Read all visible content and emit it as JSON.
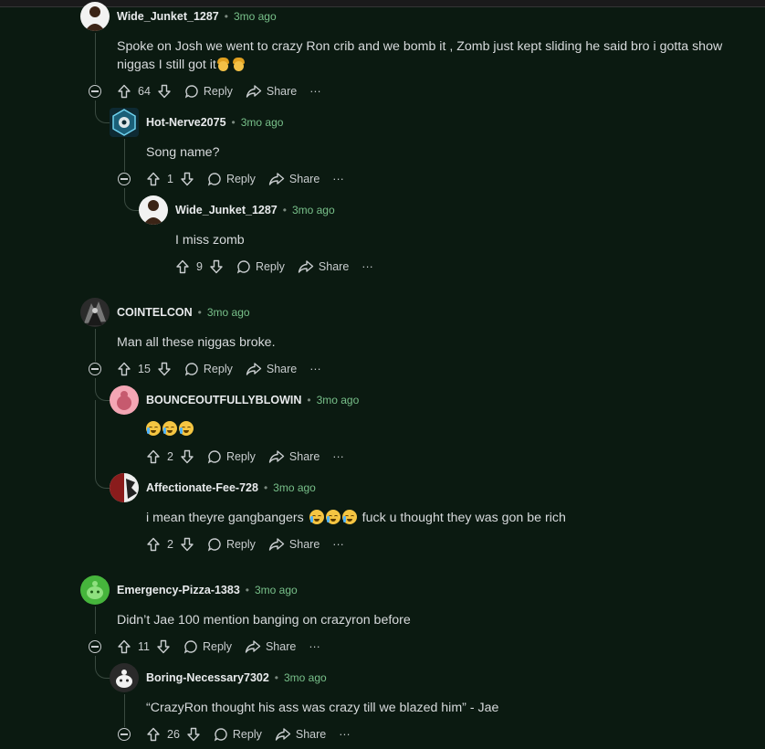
{
  "comments": [
    {
      "user": "Wide_Junket_1287",
      "time": "3mo ago",
      "text": "Spoke on Josh we went to crazy Ron crib and we bomb it , Zomb just kept sliding he said bro i gotta show",
      "text2": "niggas I still got it",
      "votes": "64",
      "reply": "Reply",
      "share": "Share",
      "more": "···"
    },
    {
      "user": "Hot-Nerve2075",
      "time": "3mo ago",
      "text": "Song name?",
      "votes": "1",
      "reply": "Reply",
      "share": "Share",
      "more": "···"
    },
    {
      "user": "Wide_Junket_1287",
      "time": "3mo ago",
      "text": "I miss zomb",
      "votes": "9",
      "reply": "Reply",
      "share": "Share",
      "more": "···"
    },
    {
      "user": "COINTELCON",
      "time": "3mo ago",
      "text": "Man all these niggas broke.",
      "votes": "15",
      "reply": "Reply",
      "share": "Share",
      "more": "···"
    },
    {
      "user": "BOUNCEOUTFULLYBLOWIN",
      "time": "3mo ago",
      "text": "",
      "votes": "2",
      "reply": "Reply",
      "share": "Share",
      "more": "···"
    },
    {
      "user": "Affectionate-Fee-728",
      "time": "3mo ago",
      "text": "i mean theyre gangbangers",
      "text2": "fuck u thought they was gon be rich",
      "votes": "2",
      "reply": "Reply",
      "share": "Share",
      "more": "···"
    },
    {
      "user": "Emergency-Pizza-1383",
      "time": "3mo ago",
      "text": "Didn’t Jae 100 mention banging on crazyron before",
      "votes": "11",
      "reply": "Reply",
      "share": "Share",
      "more": "···"
    },
    {
      "user": "Boring-Necessary7302",
      "time": "3mo ago",
      "text": "“CrazyRon thought his ass was crazy till we blazed him” - Jae",
      "votes": "26",
      "reply": "Reply",
      "share": "Share",
      "more": "···"
    }
  ],
  "colors": {
    "background": "#0b1a11",
    "timestamp": "#78c08a",
    "thread_line": "#3a4a40"
  }
}
